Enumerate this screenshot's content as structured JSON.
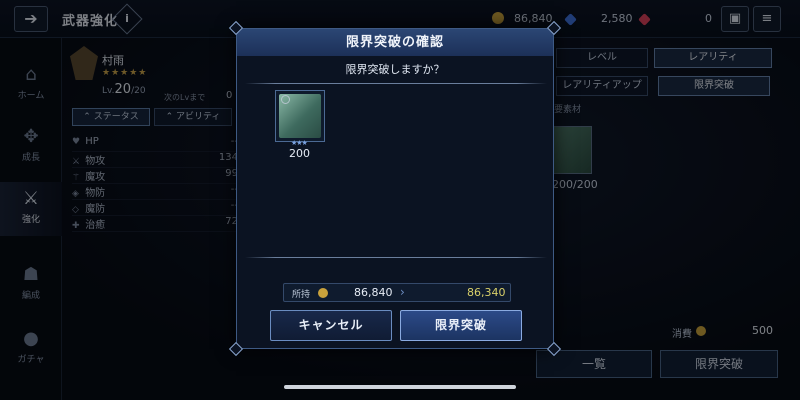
{
  "header": {
    "title": "武器強化",
    "info_icon": "i",
    "back_icon": "back-arrow-icon",
    "currencies": [
      {
        "name": "gold-coin-icon",
        "value": "86,840",
        "color": "#c9a23c"
      },
      {
        "name": "blue-crystal-icon",
        "value": "2,580",
        "color": "#3d6fd8"
      },
      {
        "name": "red-crystal-icon",
        "value": "0",
        "color": "#d8405a"
      }
    ],
    "bag_icon": "bag-icon",
    "menu_icon": "menu-icon"
  },
  "sidenav": {
    "items": [
      {
        "label": "ホーム",
        "icon": "home-icon"
      },
      {
        "label": "成長",
        "icon": "growth-icon"
      },
      {
        "label": "強化",
        "icon": "sword-icon",
        "active": true
      },
      {
        "label": "編成",
        "icon": "party-icon"
      },
      {
        "label": "ガチャ",
        "icon": "gacha-icon"
      }
    ]
  },
  "character": {
    "name": "村雨",
    "stars": "★★★★★",
    "lv_prefix": "Lv.",
    "lv_current": "20",
    "lv_max": "/20",
    "next_lv_label": "次のLvまで",
    "next_lv_value": "0",
    "tabs": [
      "ステータス",
      "アビリティ"
    ],
    "stats": [
      {
        "label": "HP",
        "value": "--"
      },
      {
        "label": "物攻",
        "value": "134"
      },
      {
        "label": "魔攻",
        "value": "99"
      },
      {
        "label": "物防",
        "value": "--"
      },
      {
        "label": "魔防",
        "value": "--"
      },
      {
        "label": "治癒",
        "value": "72"
      }
    ]
  },
  "right_panel": {
    "tabs_top": [
      "レベル",
      "レアリティ"
    ],
    "tabs_sub": [
      "レアリティアップ",
      "限界突破"
    ],
    "material_label": "要素材",
    "material_count": "200/200",
    "cost_label": "消費",
    "cost_value": "500",
    "list_button": "一覧",
    "break_button": "限界突破"
  },
  "modal": {
    "title": "限界突破の確認",
    "question": "限界突破しますか？",
    "item_stars": "★★★",
    "item_count": "200",
    "owned_label": "所持",
    "owned_current": "86,840",
    "owned_after": "86,340",
    "cancel_label": "キャンセル",
    "confirm_label": "限界突破"
  }
}
